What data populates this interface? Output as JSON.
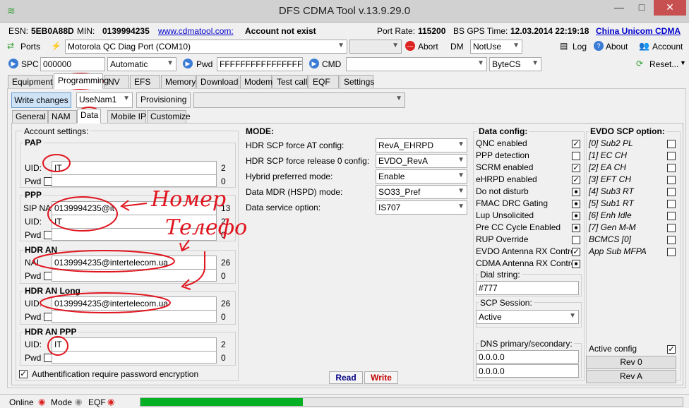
{
  "window": {
    "title": "DFS CDMA Tool v.13.9.29.0",
    "minimize": "—",
    "maximize": "□",
    "close": "✕"
  },
  "info": {
    "esn_label": "ESN:",
    "esn": "5EB0A88D",
    "min_label": "MIN:",
    "min": "0139994235",
    "link": "www.cdmatool.com:",
    "account_status": "Account not exist",
    "port_rate_label": "Port Rate:",
    "port_rate": "115200",
    "gps_label": "BS GPS Time:",
    "gps_time": "12.03.2014 22:19:18",
    "operator": "China Unicom CDMA"
  },
  "toolbar1": {
    "ports": "Ports",
    "port_selected": "Motorola QC Diag Port (COM10)",
    "abort": "Abort",
    "dm_label": "DM",
    "dm_value": "NotUse",
    "log": "Log",
    "about": "About",
    "account": "Account"
  },
  "toolbar2": {
    "spc": "SPC",
    "spc_value": "000000",
    "spc_mode": "Automatic",
    "pwd": "Pwd",
    "pwd_value": "FFFFFFFFFFFFFFFF",
    "cmd": "CMD",
    "cmd_mode": "ByteCS",
    "reset": "Reset..."
  },
  "main_tabs": [
    "Equipment",
    "Programming",
    "NV",
    "EFS",
    "Memory",
    "Download",
    "Modem",
    "Test call",
    "EQF",
    "Settings"
  ],
  "prog_bar": {
    "write_changes": "Write changes",
    "nam": "UseNam1",
    "provisioning": "Provisioning"
  },
  "sub_tabs": [
    "General",
    "NAM",
    "Data",
    "Mobile IP",
    "Customize"
  ],
  "account": {
    "title": "Account settings:",
    "pap": {
      "title": "PAP",
      "uid_label": "UID:",
      "uid": "IT",
      "uid_len": "2",
      "pwd_label": "Pwd",
      "pwd_len": "0"
    },
    "ppp": {
      "title": "PPP",
      "sip_label": "SIP NAI",
      "sip": "0139994235@it",
      "sip_len": "13",
      "uid_label": "UID:",
      "uid": "IT",
      "uid_len": "2",
      "pwd_label": "Pwd",
      "pwd_len": "0"
    },
    "hdr_an": {
      "title": "HDR AN",
      "nai_label": "NAI",
      "nai": "0139994235@intertelecom.ua",
      "nai_len": "26",
      "pwd_label": "Pwd",
      "pwd_len": "0"
    },
    "hdr_an_long": {
      "title": "HDR AN Long",
      "uid_label": "UID:",
      "uid": "0139994235@intertelecom.ua",
      "uid_len": "26",
      "pwd_label": "Pwd",
      "pwd_len": "0"
    },
    "hdr_an_ppp": {
      "title": "HDR AN PPP",
      "uid_label": "UID:",
      "uid": "IT",
      "uid_len": "2",
      "pwd_label": "Pwd",
      "pwd_len": "0"
    },
    "auth": "Authentification require password encryption"
  },
  "mode": {
    "title": "MODE:",
    "rows": [
      {
        "label": "HDR SCP force AT config:",
        "value": "RevA_EHRPD"
      },
      {
        "label": "HDR SCP force release 0 config:",
        "value": "EVDO_RevA"
      },
      {
        "label": "Hybrid preferred mode:",
        "value": "Enable"
      },
      {
        "label": "Data MDR (HSPD) mode:",
        "value": "SO33_Pref"
      },
      {
        "label": "Data service option:",
        "value": "IS707"
      }
    ],
    "read": "Read",
    "write": "Write"
  },
  "data_config": {
    "title": "Data config:",
    "items": [
      {
        "label": "QNC enabled",
        "state": "✓"
      },
      {
        "label": "PPP detection",
        "state": ""
      },
      {
        "label": "SCRM enabled",
        "state": "✓"
      },
      {
        "label": "eHRPD enabled",
        "state": "✓"
      },
      {
        "label": "Do not disturb",
        "state": "■"
      },
      {
        "label": "FMAC DRC Gating",
        "state": "■"
      },
      {
        "label": "Lup Unsolicited",
        "state": "■"
      },
      {
        "label": "Pre CC Cycle Enabled",
        "state": "■"
      },
      {
        "label": "RUP Override",
        "state": ""
      },
      {
        "label": "EVDO Antenna RX Control",
        "state": "✓"
      },
      {
        "label": "CDMA Antenna RX Control",
        "state": "■"
      }
    ],
    "dial_label": "Dial string:",
    "dial": "#777",
    "scp_label": "SCP Session:",
    "scp": "Active",
    "dns_label": "DNS primary/secondary:",
    "dns1": "0.0.0.0",
    "dns2": "0.0.0.0"
  },
  "evdo": {
    "title": "EVDO SCP option:",
    "items": [
      "[0] Sub2 PL",
      "[1] EC CH",
      "[2] EA CH",
      "[3] EFT CH",
      "[4] Sub3 RT",
      "[5] Sub1 RT",
      "[6] Enh Idle",
      "[7] Gen M-M",
      "BCMCS [0]",
      "App Sub MFPA"
    ],
    "active_config": "Active config",
    "rev0": "Rev 0",
    "reva": "Rev A"
  },
  "status": {
    "online": "Online",
    "mode": "Mode",
    "eqf": "EQF",
    "progress": 0.3
  },
  "annotations": {
    "word1": "Номер",
    "word2": "Телефо"
  }
}
